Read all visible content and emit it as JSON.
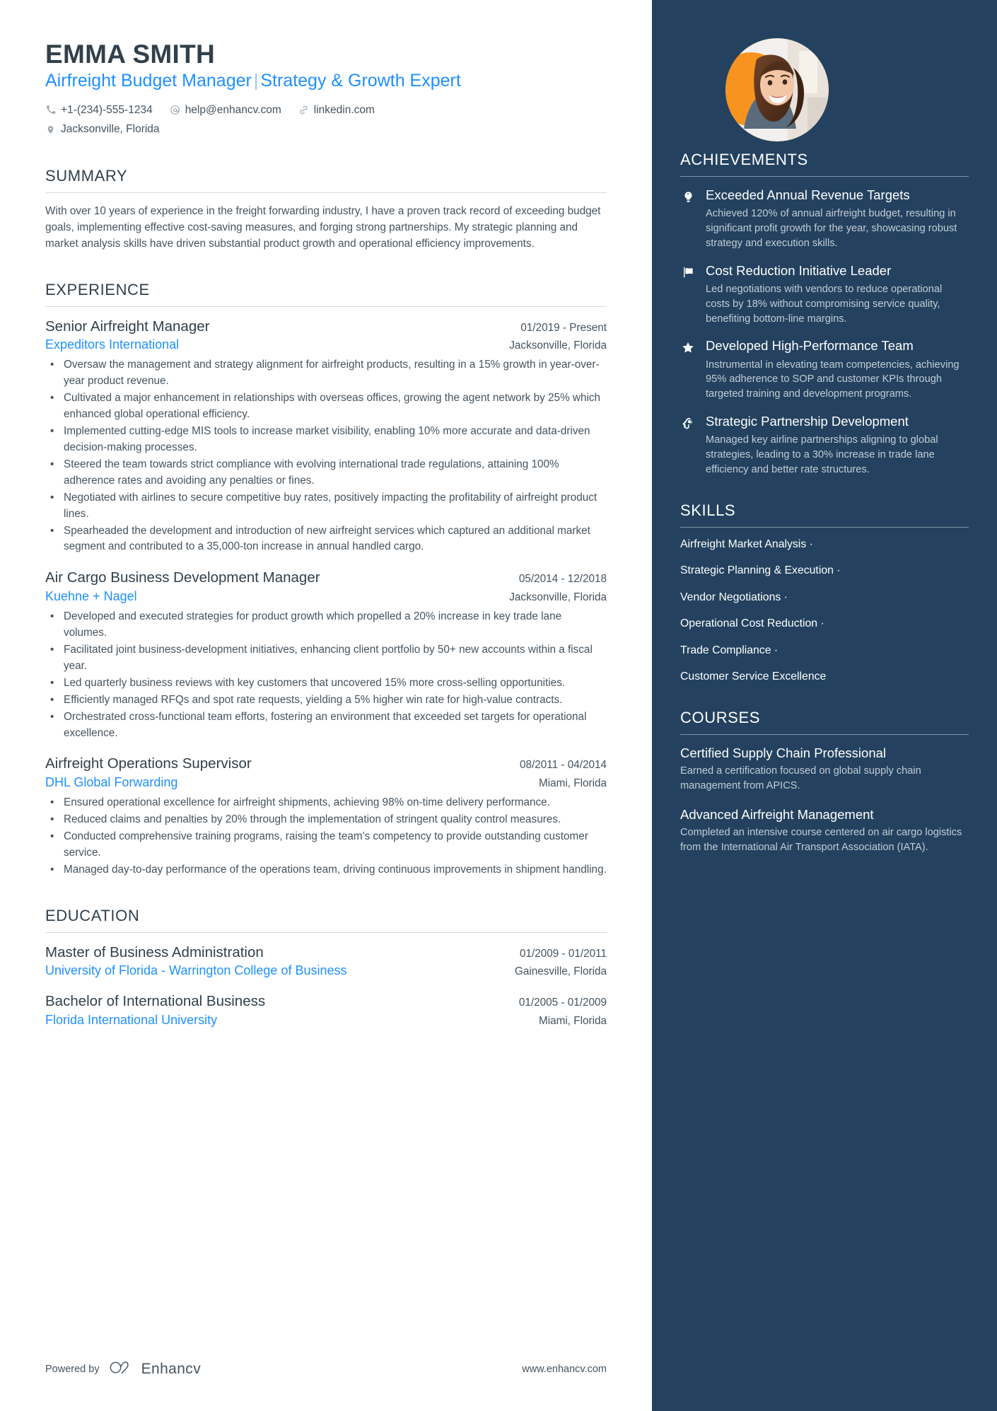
{
  "theme": {
    "accent_blue": "#1e90ff",
    "sidebar_bg": "#24425f",
    "heading_color": "#31404b",
    "body_color": "#45535e",
    "avatar_bg": "#f59338"
  },
  "header": {
    "name": "EMMA SMITH",
    "headline_left": "Airfreight Budget Manager",
    "headline_sep": "|",
    "headline_right": "Strategy & Growth Expert",
    "contacts": [
      {
        "icon": "phone-icon",
        "text": "+1-(234)-555-1234"
      },
      {
        "icon": "email-icon",
        "text": "help@enhancv.com"
      },
      {
        "icon": "link-icon",
        "text": "linkedin.com"
      }
    ],
    "location": {
      "icon": "location-pin-icon",
      "text": "Jacksonville, Florida"
    }
  },
  "summary": {
    "title": "SUMMARY",
    "text": "With over 10 years of experience in the freight forwarding industry, I have a proven track record of exceeding budget goals, implementing effective cost-saving measures, and forging strong partnerships. My strategic planning and market analysis skills have driven substantial product growth and operational efficiency improvements."
  },
  "experience": {
    "title": "EXPERIENCE",
    "entries": [
      {
        "role": "Senior Airfreight Manager",
        "dates": "01/2019 - Present",
        "company": "Expeditors International",
        "location": "Jacksonville, Florida",
        "bullets": [
          "Oversaw the management and strategy alignment for airfreight products, resulting in a 15% growth in year-over-year product revenue.",
          "Cultivated a major enhancement in relationships with overseas offices, growing the agent network by 25% which enhanced global operational efficiency.",
          "Implemented cutting-edge MIS tools to increase market visibility, enabling 10% more accurate and data-driven decision-making processes.",
          "Steered the team towards strict compliance with evolving international trade regulations, attaining 100% adherence rates and avoiding any penalties or fines.",
          "Negotiated with airlines to secure competitive buy rates, positively impacting the profitability of airfreight product lines.",
          "Spearheaded the development and introduction of new airfreight services which captured an additional market segment and contributed to a 35,000-ton increase in annual handled cargo."
        ]
      },
      {
        "role": "Air Cargo Business Development Manager",
        "dates": "05/2014 - 12/2018",
        "company": "Kuehne + Nagel",
        "location": "Jacksonville, Florida",
        "bullets": [
          "Developed and executed strategies for product growth which propelled a 20% increase in key trade lane volumes.",
          "Facilitated joint business-development initiatives, enhancing client portfolio by 50+ new accounts within a fiscal year.",
          "Led quarterly business reviews with key customers that uncovered 15% more cross-selling opportunities.",
          "Efficiently managed RFQs and spot rate requests, yielding a 5% higher win rate for high-value contracts.",
          "Orchestrated cross-functional team efforts, fostering an environment that exceeded set targets for operational excellence."
        ]
      },
      {
        "role": "Airfreight Operations Supervisor",
        "dates": "08/2011 - 04/2014",
        "company": "DHL Global Forwarding",
        "location": "Miami, Florida",
        "bullets": [
          "Ensured operational excellence for airfreight shipments, achieving 98% on-time delivery performance.",
          "Reduced claims and penalties by 20% through the implementation of stringent quality control measures.",
          "Conducted comprehensive training programs, raising the team's competency to provide outstanding customer service.",
          "Managed day-to-day performance of the operations team, driving continuous improvements in shipment handling."
        ]
      }
    ]
  },
  "education": {
    "title": "EDUCATION",
    "entries": [
      {
        "degree": "Master of Business Administration",
        "dates": "01/2009 - 01/2011",
        "school": "University of Florida - Warrington College of Business",
        "location": "Gainesville, Florida"
      },
      {
        "degree": "Bachelor of International Business",
        "dates": "01/2005 - 01/2009",
        "school": "Florida International University",
        "location": "Miami, Florida"
      }
    ]
  },
  "achievements": {
    "title": "ACHIEVEMENTS",
    "items": [
      {
        "icon": "lightbulb-icon",
        "title": "Exceeded Annual Revenue Targets",
        "description": "Achieved 120% of annual airfreight budget, resulting in significant profit growth for the year, showcasing robust strategy and execution skills."
      },
      {
        "icon": "flag-icon",
        "title": "Cost Reduction Initiative Leader",
        "description": "Led negotiations with vendors to reduce operational costs by 18% without compromising service quality, benefiting bottom-line margins."
      },
      {
        "icon": "star-icon",
        "title": "Developed High-Performance Team",
        "description": "Instrumental in elevating team competencies, achieving 95% adherence to SOP and customer KPIs through targeted training and development programs."
      },
      {
        "icon": "head-idea-icon",
        "title": "Strategic Partnership Development",
        "description": "Managed key airline partnerships aligning to global strategies, leading to a 30% increase in trade lane efficiency and better rate structures."
      }
    ]
  },
  "skills": {
    "title": "SKILLS",
    "items": [
      "Airfreight Market Analysis ·",
      "Strategic Planning & Execution ·",
      "Vendor Negotiations ·",
      "Operational Cost Reduction ·",
      "Trade Compliance ·",
      "Customer Service Excellence"
    ]
  },
  "courses": {
    "title": "COURSES",
    "items": [
      {
        "title": "Certified Supply Chain Professional",
        "description": "Earned a certification focused on global supply chain management from APICS."
      },
      {
        "title": "Advanced Airfreight Management",
        "description": "Completed an intensive course centered on air cargo logistics from the International Air Transport Association (IATA)."
      }
    ]
  },
  "footer": {
    "powered_by": "Powered by",
    "brand": "Enhancv",
    "url": "www.enhancv.com"
  }
}
